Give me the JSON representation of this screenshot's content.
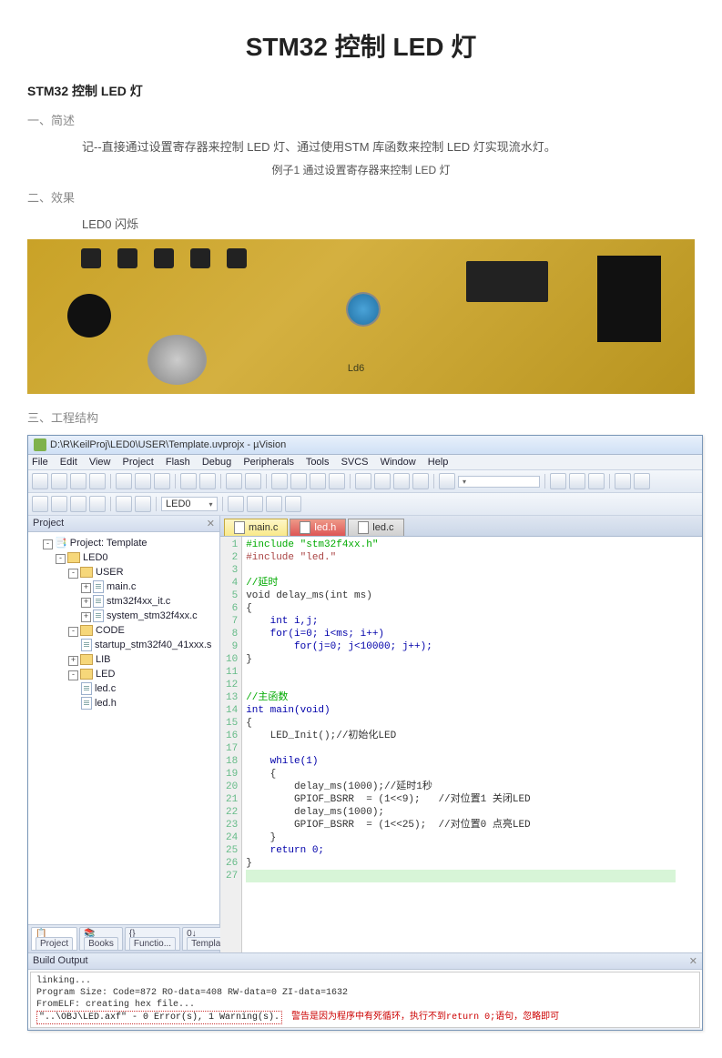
{
  "title": "STM32 控制 LED 灯",
  "subtitle": "STM32 控制 LED 灯",
  "section1": "一、简述",
  "desc1": "记--直接通过设置寄存器来控制 LED 灯、通过使用STM 库函数来控制 LED 灯实现流水灯。",
  "example1": "例子1  通过设置寄存器来控制 LED 灯",
  "section2": "二、效果",
  "effect_note": "LED0 闪烁",
  "section3": "三、工程结构",
  "ide": {
    "title": "D:\\R\\KeilProj\\LED0\\USER\\Template.uvprojx - µVision",
    "menus": [
      "File",
      "Edit",
      "View",
      "Project",
      "Flash",
      "Debug",
      "Peripherals",
      "Tools",
      "SVCS",
      "Window",
      "Help"
    ],
    "target_combo": "LED0",
    "project_pane_title": "Project",
    "tree": {
      "root": "Project: Template",
      "target": "LED0",
      "groups": [
        {
          "name": "USER",
          "files": [
            "main.c",
            "stm32f4xx_it.c",
            "system_stm32f4xx.c"
          ]
        },
        {
          "name": "CODE",
          "files": [
            "startup_stm32f40_41xxx.s"
          ]
        },
        {
          "name": "LIB",
          "files": []
        },
        {
          "name": "LED",
          "files": [
            "led.c",
            "led.h"
          ]
        }
      ]
    },
    "proj_tabs": [
      "Project",
      "Books",
      "Functio...",
      "Templat..."
    ],
    "editor_tabs": [
      {
        "label": "main.c",
        "state": "active"
      },
      {
        "label": "led.h",
        "state": "red"
      },
      {
        "label": "led.c",
        "state": "normal"
      }
    ],
    "code_lines": [
      {
        "n": 1,
        "t": "#include \"stm32f4xx.h\"",
        "cls": "cm"
      },
      {
        "n": 2,
        "t": "#include \"led.\"",
        "cls": "tx"
      },
      {
        "n": 3,
        "t": "",
        "cls": "dk"
      },
      {
        "n": 4,
        "t": "//延时",
        "cls": "cm"
      },
      {
        "n": 5,
        "t": "void delay_ms(int ms)",
        "cls": "dk"
      },
      {
        "n": 6,
        "t": "{",
        "cls": "dk"
      },
      {
        "n": 7,
        "t": "    int i,j;",
        "cls": "kw"
      },
      {
        "n": 8,
        "t": "    for(i=0; i<ms; i++)",
        "cls": "kw"
      },
      {
        "n": 9,
        "t": "        for(j=0; j<10000; j++);",
        "cls": "kw"
      },
      {
        "n": 10,
        "t": "}",
        "cls": "dk"
      },
      {
        "n": 11,
        "t": "",
        "cls": "dk"
      },
      {
        "n": 12,
        "t": "",
        "cls": "dk"
      },
      {
        "n": 13,
        "t": "//主函数",
        "cls": "cm"
      },
      {
        "n": 14,
        "t": "int main(void)",
        "cls": "kw"
      },
      {
        "n": 15,
        "t": "{",
        "cls": "dk"
      },
      {
        "n": 16,
        "t": "    LED_Init();//初始化LED",
        "cls": "dk"
      },
      {
        "n": 17,
        "t": "",
        "cls": "dk"
      },
      {
        "n": 18,
        "t": "    while(1)",
        "cls": "kw"
      },
      {
        "n": 19,
        "t": "    {",
        "cls": "dk"
      },
      {
        "n": 20,
        "t": "        delay_ms(1000);//延时1秒",
        "cls": "dk"
      },
      {
        "n": 21,
        "t": "        GPIOF_BSRR  = (1<<9);   //对位置1 关闭LED",
        "cls": "dk"
      },
      {
        "n": 22,
        "t": "        delay_ms(1000);",
        "cls": "dk"
      },
      {
        "n": 23,
        "t": "        GPIOF_BSRR  = (1<<25);  //对位置0 点亮LED",
        "cls": "dk"
      },
      {
        "n": 24,
        "t": "    }",
        "cls": "dk"
      },
      {
        "n": 25,
        "t": "    return 0;",
        "cls": "kw"
      },
      {
        "n": 26,
        "t": "}",
        "cls": "dk"
      },
      {
        "n": 27,
        "t": "",
        "cls": "hl"
      }
    ],
    "build_title": "Build Output",
    "build_lines": {
      "l1": "linking...",
      "l2": "Program Size: Code=872 RO-data=408 RW-data=0 ZI-data=1632",
      "l3": "FromELF: creating hex file...",
      "l4a": "\"..\\OBJ\\LED.axf\" - 0 Error(s), 1 Warning(s).",
      "l4b": "警告是因为程序中有死循环，执行不到return 0;语句，忽略即可"
    }
  }
}
